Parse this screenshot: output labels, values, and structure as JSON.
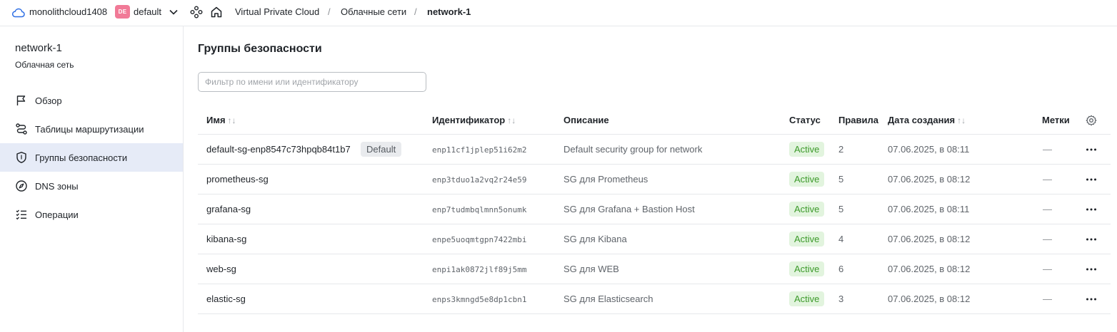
{
  "topbar": {
    "cloud_name": "monolithcloud1408",
    "cloud_badge": "DE",
    "folder": "default",
    "breadcrumbs": [
      "Virtual Private Cloud",
      "Облачные сети",
      "network-1"
    ],
    "separator": "/"
  },
  "sidebar": {
    "title": "network-1",
    "subtitle": "Облачная сеть",
    "items": [
      {
        "label": "Обзор",
        "icon": "flag-icon"
      },
      {
        "label": "Таблицы маршрутизации",
        "icon": "route-icon"
      },
      {
        "label": "Группы безопасности",
        "icon": "shield-icon",
        "active": true
      },
      {
        "label": "DNS зоны",
        "icon": "compass-icon"
      },
      {
        "label": "Операции",
        "icon": "list-check-icon"
      }
    ]
  },
  "main": {
    "title": "Группы безопасности",
    "filter_placeholder": "Фильтр по имени или идентификатору",
    "columns": {
      "name": "Имя",
      "id": "Идентификатор",
      "desc": "Описание",
      "status": "Статус",
      "rules": "Правила",
      "created": "Дата создания",
      "labels": "Метки",
      "sort_glyph": "↑↓"
    },
    "rows": [
      {
        "name": "default-sg-enp8547c73hpqb84t1b7",
        "badge": "Default",
        "id": "enp11cf1jplep51i62m2",
        "desc": "Default security group for network",
        "status": "Active",
        "rules": "2",
        "created": "07.06.2025, в 08:11",
        "labels": "—"
      },
      {
        "name": "prometheus-sg",
        "id": "enp3tduo1a2vq2r24e59",
        "desc": "SG для Prometheus",
        "status": "Active",
        "rules": "5",
        "created": "07.06.2025, в 08:12",
        "labels": "—"
      },
      {
        "name": "grafana-sg",
        "id": "enp7tudmbqlmnn5onumk",
        "desc": "SG для Grafana + Bastion Host",
        "status": "Active",
        "rules": "5",
        "created": "07.06.2025, в 08:11",
        "labels": "—"
      },
      {
        "name": "kibana-sg",
        "id": "enpe5uoqmtgpn7422mbi",
        "desc": "SG для Kibana",
        "status": "Active",
        "rules": "4",
        "created": "07.06.2025, в 08:12",
        "labels": "—"
      },
      {
        "name": "web-sg",
        "id": "enpi1ak0872jlf89j5mm",
        "desc": "SG для WEB",
        "status": "Active",
        "rules": "6",
        "created": "07.06.2025, в 08:12",
        "labels": "—"
      },
      {
        "name": "elastic-sg",
        "id": "enps3kmngd5e8dp1cbn1",
        "desc": "SG для Elasticsearch",
        "status": "Active",
        "rules": "3",
        "created": "07.06.2025, в 08:12",
        "labels": "—"
      }
    ]
  },
  "colors": {
    "active_bg": "#e2f4de",
    "active_text": "#3c9a2a",
    "badge_de": "#f17a97",
    "sidebar_active": "#e6ebf7"
  }
}
